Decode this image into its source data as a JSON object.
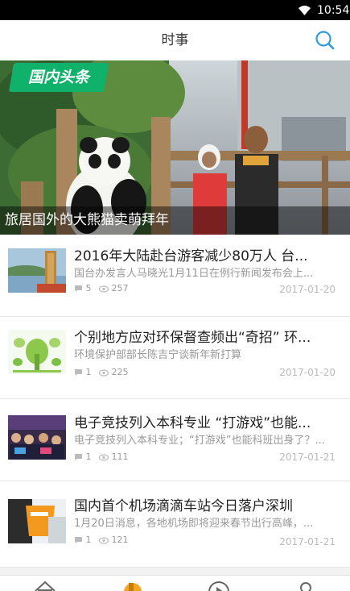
{
  "status": {
    "time": "10:54"
  },
  "header": {
    "title": "时事"
  },
  "banner": {
    "tag": "国内头条",
    "caption": "旅居国外的大熊猫卖萌拜年"
  },
  "articles": [
    {
      "title": "2016年大陆赴台游客减少80万人 台...",
      "summary": "国台办发言人马晓光1月11日在例行新闻发布会上...",
      "comments": "5",
      "views": "257",
      "date": "2017-01-20",
      "thumb": "taiwan-scenery"
    },
    {
      "title": "个别地方应对环保督查频出“奇招” 环...",
      "summary": "环境保护部部长陈吉宁谈新年新打算",
      "comments": "1",
      "views": "225",
      "date": "2017-01-20",
      "thumb": "eco-illustration"
    },
    {
      "title": "电子竞技列入本科专业 “打游戏”也能...",
      "summary": "电子竞技列入本科专业；“打游戏”也能科班出身了？...",
      "comments": "1",
      "views": "111",
      "date": "2017-01-21",
      "thumb": "esports-arena"
    },
    {
      "title": "国内首个机场滴滴车站今日落户深圳",
      "summary": "1月20日消息，各地机场即将迎来春节出行高峰，...",
      "comments": "1",
      "views": "121",
      "date": "2017-01-21",
      "thumb": "didi-station"
    }
  ],
  "colors": {
    "accent": "#2f9de0",
    "tag_green": "#10b26b",
    "tab_active": "#f5a623"
  },
  "tabs": [
    {
      "icon": "home-icon"
    },
    {
      "icon": "news-icon"
    },
    {
      "icon": "video-icon"
    },
    {
      "icon": "profile-icon"
    }
  ]
}
